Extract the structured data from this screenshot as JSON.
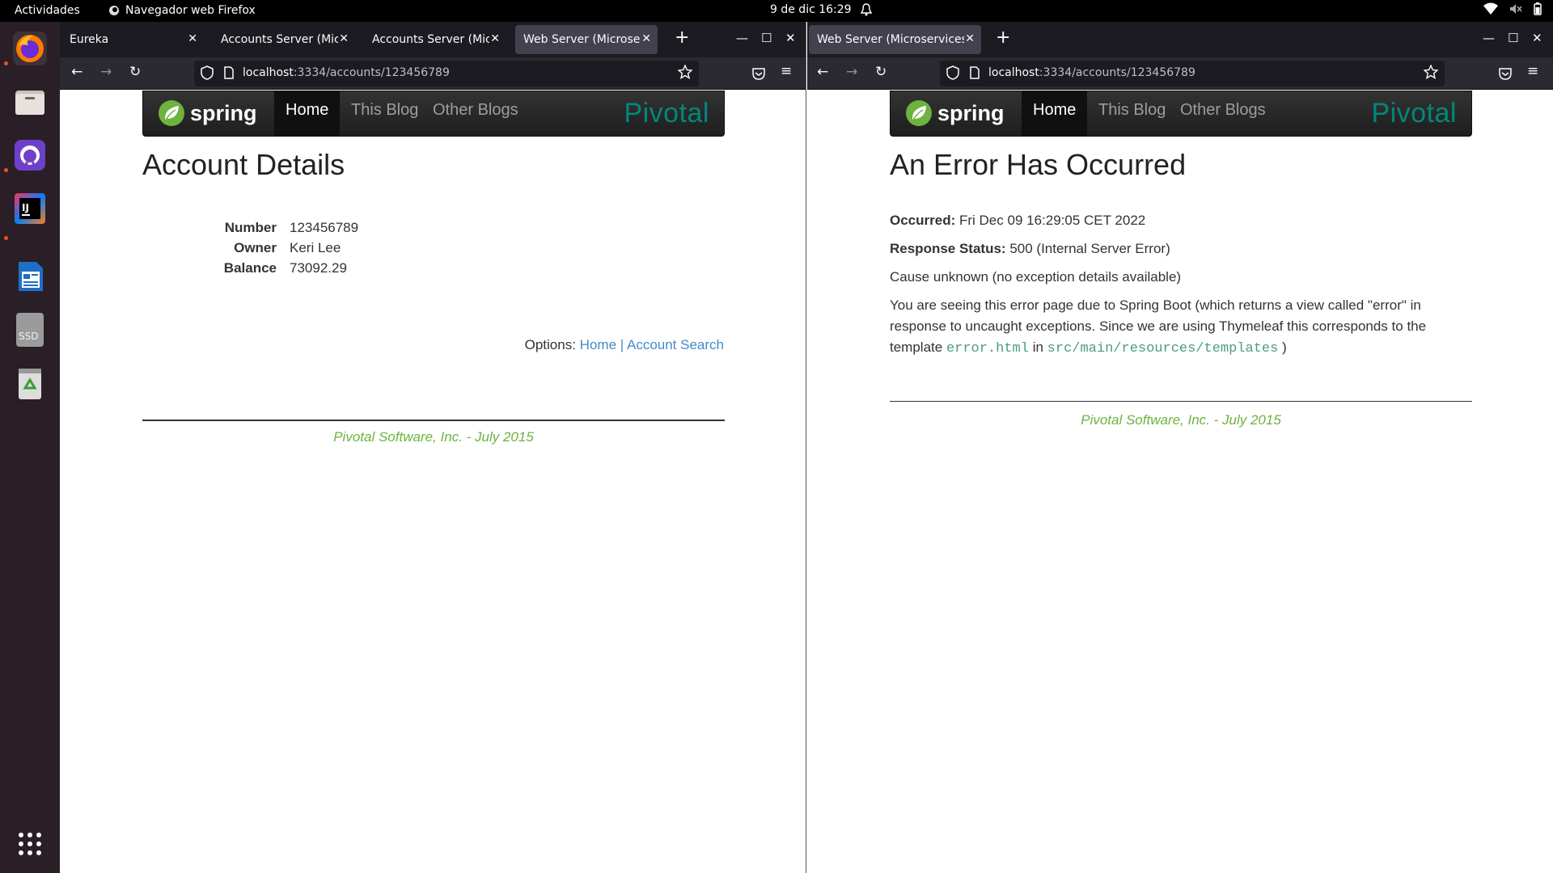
{
  "topbar": {
    "activities": "Actividades",
    "app_name": "Navegador web Firefox",
    "clock": "9 de dic  16:29"
  },
  "dock": {
    "items": [
      "firefox-icon",
      "files-icon",
      "github-desktop-icon",
      "intellij-icon",
      "writer-icon",
      "ssd-icon",
      "trash-icon",
      "app-grid-icon"
    ],
    "ssd_label": "SSD"
  },
  "left_window": {
    "tabs": [
      {
        "title": "Eureka"
      },
      {
        "title": "Accounts Server (Micro"
      },
      {
        "title": "Accounts Server (Micro"
      },
      {
        "title": "Web Server (Microserv"
      }
    ],
    "url_host": "localhost",
    "url_path": ":3334/accounts/123456789",
    "nav": {
      "logo": "spring",
      "home": "Home",
      "this_blog": "This Blog",
      "other_blogs": "Other Blogs",
      "pivotal": "Pivotal"
    },
    "heading": "Account Details",
    "details": [
      {
        "label": "Number",
        "value": "123456789"
      },
      {
        "label": "Owner",
        "value": "Keri Lee"
      },
      {
        "label": "Balance",
        "value": "73092.29"
      }
    ],
    "options_label": "Options:",
    "options_home": "Home",
    "options_sep": "|",
    "options_search": "Account Search",
    "footer": "Pivotal Software, Inc. - July 2015"
  },
  "right_window": {
    "tabs": [
      {
        "title": "Web Server (Microservices B"
      }
    ],
    "url_host": "localhost",
    "url_path": ":3334/accounts/123456789",
    "nav": {
      "logo": "spring",
      "home": "Home",
      "this_blog": "This Blog",
      "other_blogs": "Other Blogs",
      "pivotal": "Pivotal"
    },
    "heading": "An Error Has Occurred",
    "occurred_label": "Occurred:",
    "occurred_value": "Fri Dec 09 16:29:05 CET 2022",
    "status_label": "Response Status:",
    "status_value": "500 (Internal Server Error)",
    "cause": "Cause unknown (no exception details available)",
    "explain_1": "You are seeing this error page due to Spring Boot (which returns a view called \"error\" in response to uncaught exceptions. Since we are using Thymeleaf this corresponds to the template",
    "explain_file": "error.html",
    "explain_in": "in",
    "explain_dir": "src/main/resources/templates",
    "explain_end": ")",
    "footer": "Pivotal Software, Inc. - July 2015"
  },
  "colors": {
    "accent": "#e95420",
    "spring_green": "#6db33f",
    "link": "#428bca",
    "pivotal_teal": "#00887a"
  }
}
